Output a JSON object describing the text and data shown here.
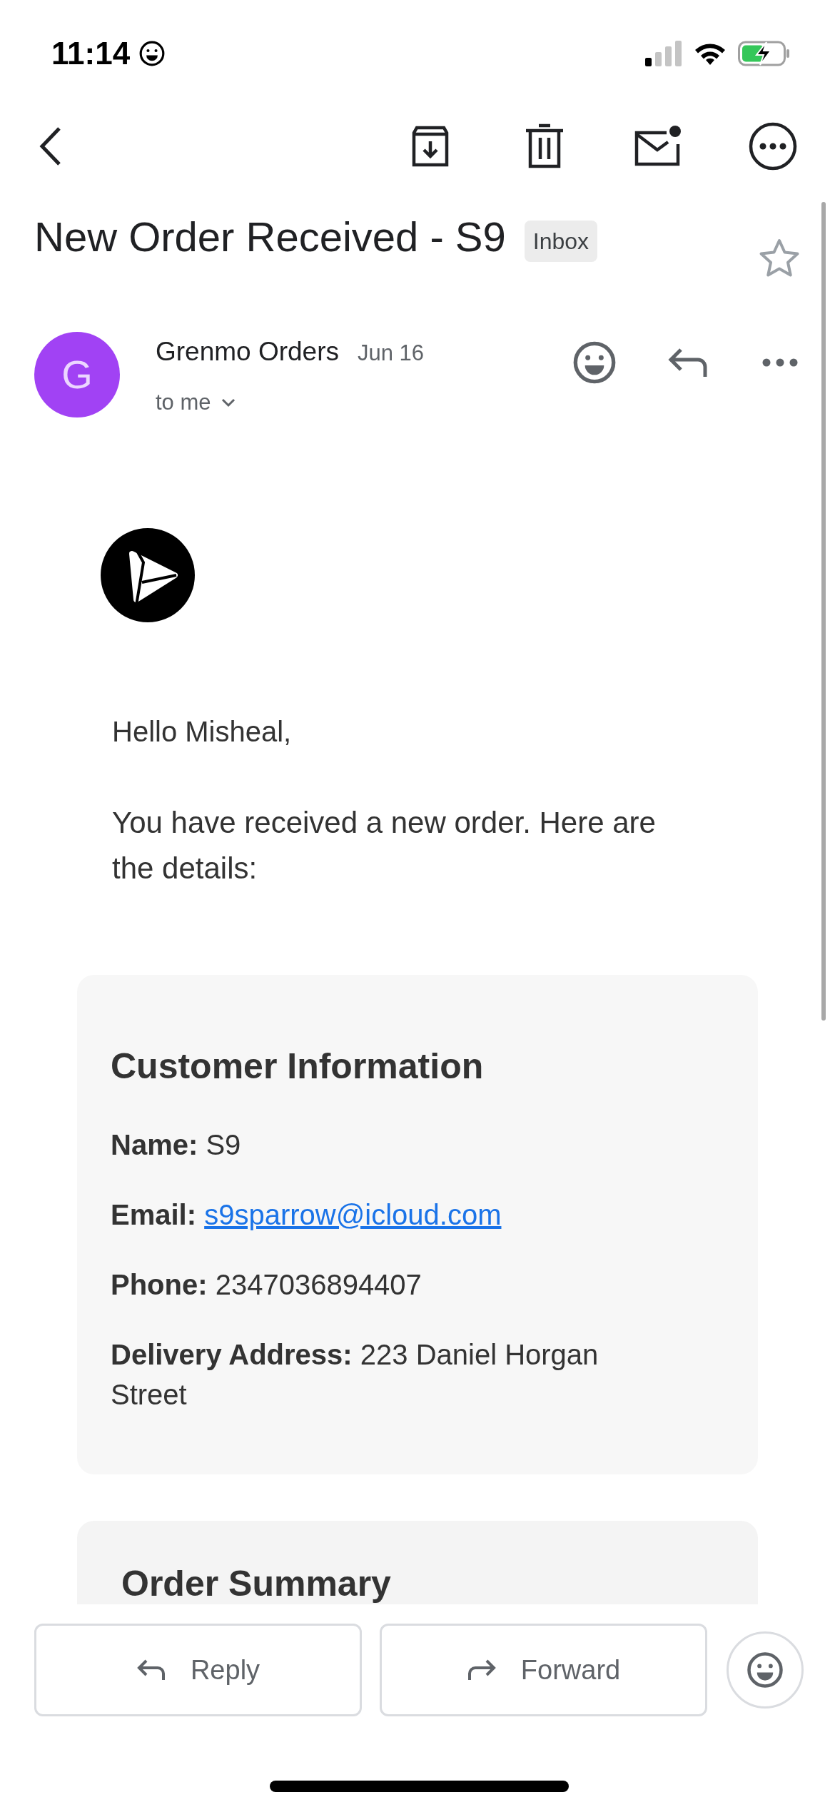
{
  "status_bar": {
    "time": "11:14"
  },
  "subject": "New Order Received - S9",
  "label": "Inbox",
  "starred": false,
  "sender": {
    "initial": "G",
    "name": "Grenmo Orders",
    "date": "Jun 16",
    "recipient": "to me"
  },
  "body": {
    "greeting": "Hello Misheal,",
    "intro": "You have received a new order. Here are the details:"
  },
  "customer_card": {
    "title": "Customer Information",
    "fields": [
      {
        "kind": "text",
        "label": "Name:",
        "value": "S9"
      },
      {
        "kind": "link",
        "label": "Email:",
        "value": "s9sparrow@icloud.com"
      },
      {
        "kind": "text",
        "label": "Phone:",
        "value": "2347036894407"
      },
      {
        "kind": "text",
        "label": "Delivery Address:",
        "value": "223 Daniel Horgan Street"
      }
    ]
  },
  "order_card": {
    "title": "Order Summary"
  },
  "actions": [
    "Reply",
    "Forward"
  ]
}
